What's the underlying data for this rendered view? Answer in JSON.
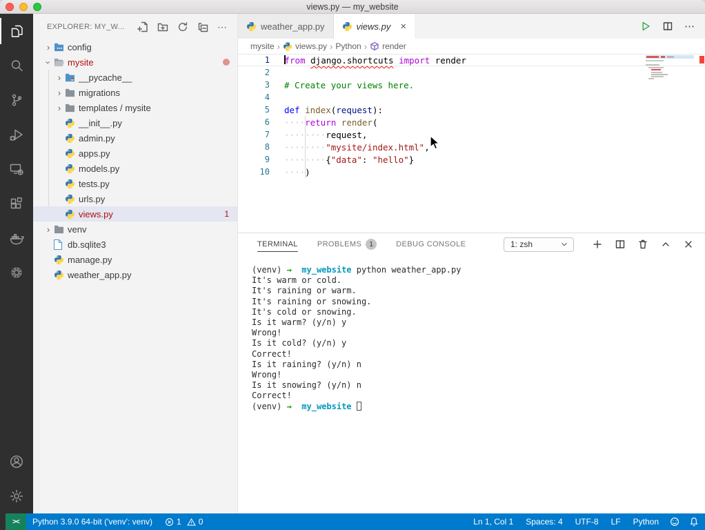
{
  "window": {
    "title": "views.py — my_website"
  },
  "colors": {
    "status_bar": "#007ACC",
    "remote_indicator": "#16825D",
    "activity_bar": "#2F2F2F",
    "error_text": "#B01011",
    "keyword": "#AF00DB",
    "keyword_def": "#0000FF",
    "comment": "#008000",
    "string": "#A31515",
    "function": "#795E26",
    "terminal_dir": "#0598BC",
    "terminal_arrow": "#13A10E",
    "run_button": "#2D9D3F"
  },
  "activity_bar": {
    "top": [
      {
        "name": "explorer",
        "active": true
      },
      {
        "name": "search",
        "active": false
      },
      {
        "name": "source-control",
        "active": false
      },
      {
        "name": "run-and-debug",
        "active": false
      },
      {
        "name": "remote-explorer",
        "active": false
      },
      {
        "name": "extensions",
        "active": false
      },
      {
        "name": "docker",
        "active": false
      },
      {
        "name": "extension-wheel",
        "active": false
      }
    ],
    "bottom": [
      {
        "name": "accounts",
        "active": false
      },
      {
        "name": "settings",
        "active": false
      }
    ]
  },
  "sidebar": {
    "header": "EXPLORER: MY_W...",
    "actions": [
      "new-file",
      "new-folder",
      "refresh",
      "collapse-all",
      "more"
    ],
    "tree": [
      {
        "label": "config",
        "icon": "folder-config",
        "level": 0,
        "chevron": "collapsed"
      },
      {
        "label": "mysite",
        "icon": "folder-open",
        "level": 0,
        "chevron": "expanded",
        "error": true,
        "dot": true
      },
      {
        "label": "__pycache__",
        "icon": "folder-python",
        "level": 1,
        "chevron": "collapsed"
      },
      {
        "label": "migrations",
        "icon": "folder",
        "level": 1,
        "chevron": "collapsed"
      },
      {
        "label": "templates / mysite",
        "icon": "folder",
        "level": 1,
        "chevron": "collapsed"
      },
      {
        "label": "__init__.py",
        "icon": "python",
        "level": 1
      },
      {
        "label": "admin.py",
        "icon": "python",
        "level": 1
      },
      {
        "label": "apps.py",
        "icon": "python",
        "level": 1
      },
      {
        "label": "models.py",
        "icon": "python",
        "level": 1
      },
      {
        "label": "tests.py",
        "icon": "python",
        "level": 1
      },
      {
        "label": "urls.py",
        "icon": "python",
        "level": 1
      },
      {
        "label": "views.py",
        "icon": "python",
        "level": 1,
        "selected": true,
        "error": true,
        "badge": "1"
      },
      {
        "label": "venv",
        "icon": "folder",
        "level": 0,
        "chevron": "collapsed"
      },
      {
        "label": "db.sqlite3",
        "icon": "file-db",
        "level": 0
      },
      {
        "label": "manage.py",
        "icon": "python",
        "level": 0
      },
      {
        "label": "weather_app.py",
        "icon": "python",
        "level": 0
      }
    ]
  },
  "tabs": [
    {
      "label": "weather_app.py",
      "icon": "python",
      "active": false
    },
    {
      "label": "views.py",
      "icon": "python",
      "active": true,
      "preview": true,
      "close": "×"
    }
  ],
  "editor_actions": [
    {
      "name": "run-python-file",
      "icon": "run"
    },
    {
      "name": "split-editor",
      "icon": "split"
    },
    {
      "name": "more-actions",
      "icon": "more"
    }
  ],
  "breadcrumb": [
    {
      "label": "mysite"
    },
    {
      "label": "views.py",
      "icon": "python"
    },
    {
      "label": "Python"
    },
    {
      "label": "render",
      "icon": "symbol-module"
    }
  ],
  "code": {
    "lines": [
      {
        "n": "1",
        "current": true,
        "cursor": true,
        "tokens": [
          {
            "t": "from",
            "s": "kw"
          },
          {
            "t": " "
          },
          {
            "t": "django.shortcuts",
            "err": true
          },
          {
            "t": " "
          },
          {
            "t": "import",
            "s": "kw"
          },
          {
            "t": " "
          },
          {
            "t": "render"
          }
        ]
      },
      {
        "n": "2",
        "tokens": []
      },
      {
        "n": "3",
        "tokens": [
          {
            "t": "# Create your views here.",
            "s": "cm"
          }
        ]
      },
      {
        "n": "4",
        "tokens": []
      },
      {
        "n": "5",
        "tokens": [
          {
            "t": "def",
            "s": "kwb"
          },
          {
            "t": " "
          },
          {
            "t": "index",
            "s": "fn"
          },
          {
            "t": "("
          },
          {
            "t": "request",
            "s": "pr"
          },
          {
            "t": "):"
          }
        ]
      },
      {
        "n": "6",
        "tokens": [
          {
            "t": "····",
            "s": "ws"
          },
          {
            "t": "return",
            "s": "kw"
          },
          {
            "t": " "
          },
          {
            "t": "render",
            "s": "fn"
          },
          {
            "t": "("
          }
        ]
      },
      {
        "n": "7",
        "tokens": [
          {
            "t": "········",
            "s": "ws"
          },
          {
            "t": "request,"
          }
        ]
      },
      {
        "n": "8",
        "tokens": [
          {
            "t": "········",
            "s": "ws"
          },
          {
            "t": "\"mysite/index.html\"",
            "s": "st"
          },
          {
            "t": ","
          }
        ]
      },
      {
        "n": "9",
        "tokens": [
          {
            "t": "········",
            "s": "ws"
          },
          {
            "t": "{"
          },
          {
            "t": "\"data\"",
            "s": "st"
          },
          {
            "t": ": "
          },
          {
            "t": "\"hello\"",
            "s": "st"
          },
          {
            "t": "}"
          }
        ]
      },
      {
        "n": "10",
        "tokens": [
          {
            "t": "····",
            "s": "ws"
          },
          {
            "t": ")"
          }
        ]
      }
    ]
  },
  "terminal": {
    "tabs": [
      {
        "label": "TERMINAL",
        "active": true
      },
      {
        "label": "PROBLEMS",
        "badge": "1"
      },
      {
        "label": "DEBUG CONSOLE"
      }
    ],
    "shell_selector": "1: zsh",
    "actions": [
      "new-terminal",
      "split-terminal",
      "kill-terminal",
      "maximize-panel",
      "close-panel"
    ],
    "lines": [
      {
        "parts": [
          {
            "t": "(venv) "
          },
          {
            "t": "→",
            "s": "arrow"
          },
          {
            "t": "  "
          },
          {
            "t": "my_website",
            "s": "dir"
          },
          {
            "t": " python weather_app.py"
          }
        ]
      },
      {
        "parts": [
          {
            "t": "It's warm or cold."
          }
        ]
      },
      {
        "parts": [
          {
            "t": "It's raining or warm."
          }
        ]
      },
      {
        "parts": [
          {
            "t": "It's raining or snowing."
          }
        ]
      },
      {
        "parts": [
          {
            "t": "It's cold or snowing."
          }
        ]
      },
      {
        "parts": [
          {
            "t": "Is it warm? (y/n) y"
          }
        ]
      },
      {
        "parts": [
          {
            "t": "Wrong!"
          }
        ]
      },
      {
        "parts": [
          {
            "t": "Is it cold? (y/n) y"
          }
        ]
      },
      {
        "parts": [
          {
            "t": "Correct!"
          }
        ]
      },
      {
        "parts": [
          {
            "t": "Is it raining? (y/n) n"
          }
        ]
      },
      {
        "parts": [
          {
            "t": "Wrong!"
          }
        ]
      },
      {
        "parts": [
          {
            "t": "Is it snowing? (y/n) n"
          }
        ]
      },
      {
        "parts": [
          {
            "t": "Correct!"
          }
        ]
      },
      {
        "parts": [
          {
            "t": "(venv) "
          },
          {
            "t": "→",
            "s": "arrow"
          },
          {
            "t": "  "
          },
          {
            "t": "my_website",
            "s": "dir"
          },
          {
            "t": " "
          }
        ],
        "cursor": true
      }
    ]
  },
  "status_bar": {
    "remote_icon": "><",
    "interpreter": "Python 3.9.0 64-bit ('venv': venv)",
    "errors": "1",
    "warnings": "0",
    "right_items": [
      {
        "name": "cursor-position",
        "label": "Ln 1, Col 1"
      },
      {
        "name": "indentation",
        "label": "Spaces: 4"
      },
      {
        "name": "encoding",
        "label": "UTF-8"
      },
      {
        "name": "eol",
        "label": "LF"
      },
      {
        "name": "language-mode",
        "label": "Python"
      }
    ]
  }
}
